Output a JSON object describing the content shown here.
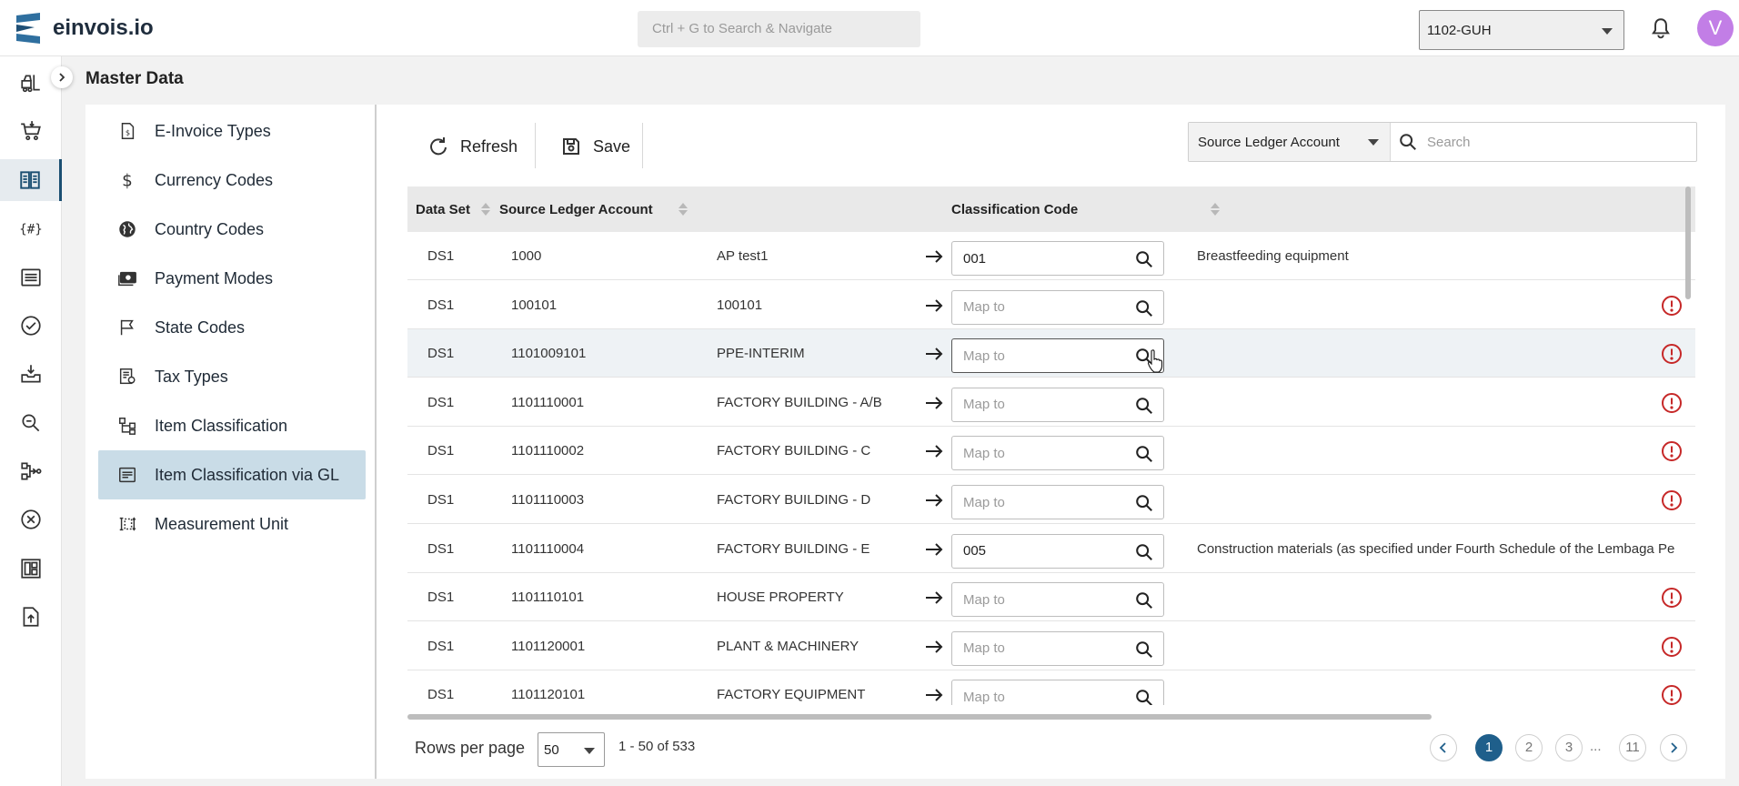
{
  "app": {
    "name": "einvois.io"
  },
  "header": {
    "search_placeholder": "Ctrl + G to Search & Navigate",
    "entity": "1102-GUH",
    "avatar_initial": "V"
  },
  "page": {
    "title": "Master Data"
  },
  "subnav": {
    "items": [
      {
        "label": "E-Invoice Types",
        "icon": "invoice-doc-icon"
      },
      {
        "label": "Currency Codes",
        "icon": "dollar-icon"
      },
      {
        "label": "Country Codes",
        "icon": "globe-icon"
      },
      {
        "label": "Payment Modes",
        "icon": "payment-icon"
      },
      {
        "label": "State Codes",
        "icon": "flag-icon"
      },
      {
        "label": "Tax Types",
        "icon": "tax-doc-icon"
      },
      {
        "label": "Item Classification",
        "icon": "hierarchy-icon"
      },
      {
        "label": "Item Classification via GL",
        "icon": "list-box-icon"
      },
      {
        "label": "Measurement Unit",
        "icon": "measure-icon"
      }
    ],
    "active_index": 7
  },
  "toolbar": {
    "refresh_label": "Refresh",
    "save_label": "Save",
    "filter_field": "Source Ledger Account",
    "search_placeholder": "Search"
  },
  "table": {
    "columns": {
      "data_set": "Data Set",
      "source_ledger_account": "Source Ledger Account",
      "classification_code": "Classification Code"
    },
    "map_placeholder": "Map to",
    "rows": [
      {
        "data_set": "DS1",
        "account": "1000",
        "name": "AP test1",
        "code": "001",
        "description": "Breastfeeding equipment",
        "warning": false
      },
      {
        "data_set": "DS1",
        "account": "100101",
        "name": "100101",
        "code": "",
        "description": "",
        "warning": true
      },
      {
        "data_set": "DS1",
        "account": "1101009101",
        "name": "PPE-INTERIM",
        "code": "",
        "description": "",
        "warning": true
      },
      {
        "data_set": "DS1",
        "account": "1101110001",
        "name": "FACTORY BUILDING - A/B",
        "code": "",
        "description": "",
        "warning": true
      },
      {
        "data_set": "DS1",
        "account": "1101110002",
        "name": "FACTORY BUILDING - C",
        "code": "",
        "description": "",
        "warning": true
      },
      {
        "data_set": "DS1",
        "account": "1101110003",
        "name": "FACTORY BUILDING - D",
        "code": "",
        "description": "",
        "warning": true
      },
      {
        "data_set": "DS1",
        "account": "1101110004",
        "name": "FACTORY BUILDING - E",
        "code": "005",
        "description": "Construction materials (as specified under Fourth Schedule of the Lembaga Pe",
        "warning": false
      },
      {
        "data_set": "DS1",
        "account": "1101110101",
        "name": "HOUSE PROPERTY",
        "code": "",
        "description": "",
        "warning": true
      },
      {
        "data_set": "DS1",
        "account": "1101120001",
        "name": "PLANT & MACHINERY",
        "code": "",
        "description": "",
        "warning": true
      },
      {
        "data_set": "DS1",
        "account": "1101120101",
        "name": "FACTORY EQUIPMENT",
        "code": "",
        "description": "",
        "warning": true
      }
    ]
  },
  "footer": {
    "rows_per_page_label": "Rows per page",
    "rows_per_page": "50",
    "range": "1 - 50 of 533",
    "pages": [
      "1",
      "2",
      "3",
      "11"
    ],
    "ellipsis": "...",
    "current_page": "1"
  },
  "colors": {
    "accent": "#1f5f8b",
    "active_nav": "#c9dce7",
    "warning": "#c62828",
    "avatar": "#c27ee6"
  }
}
